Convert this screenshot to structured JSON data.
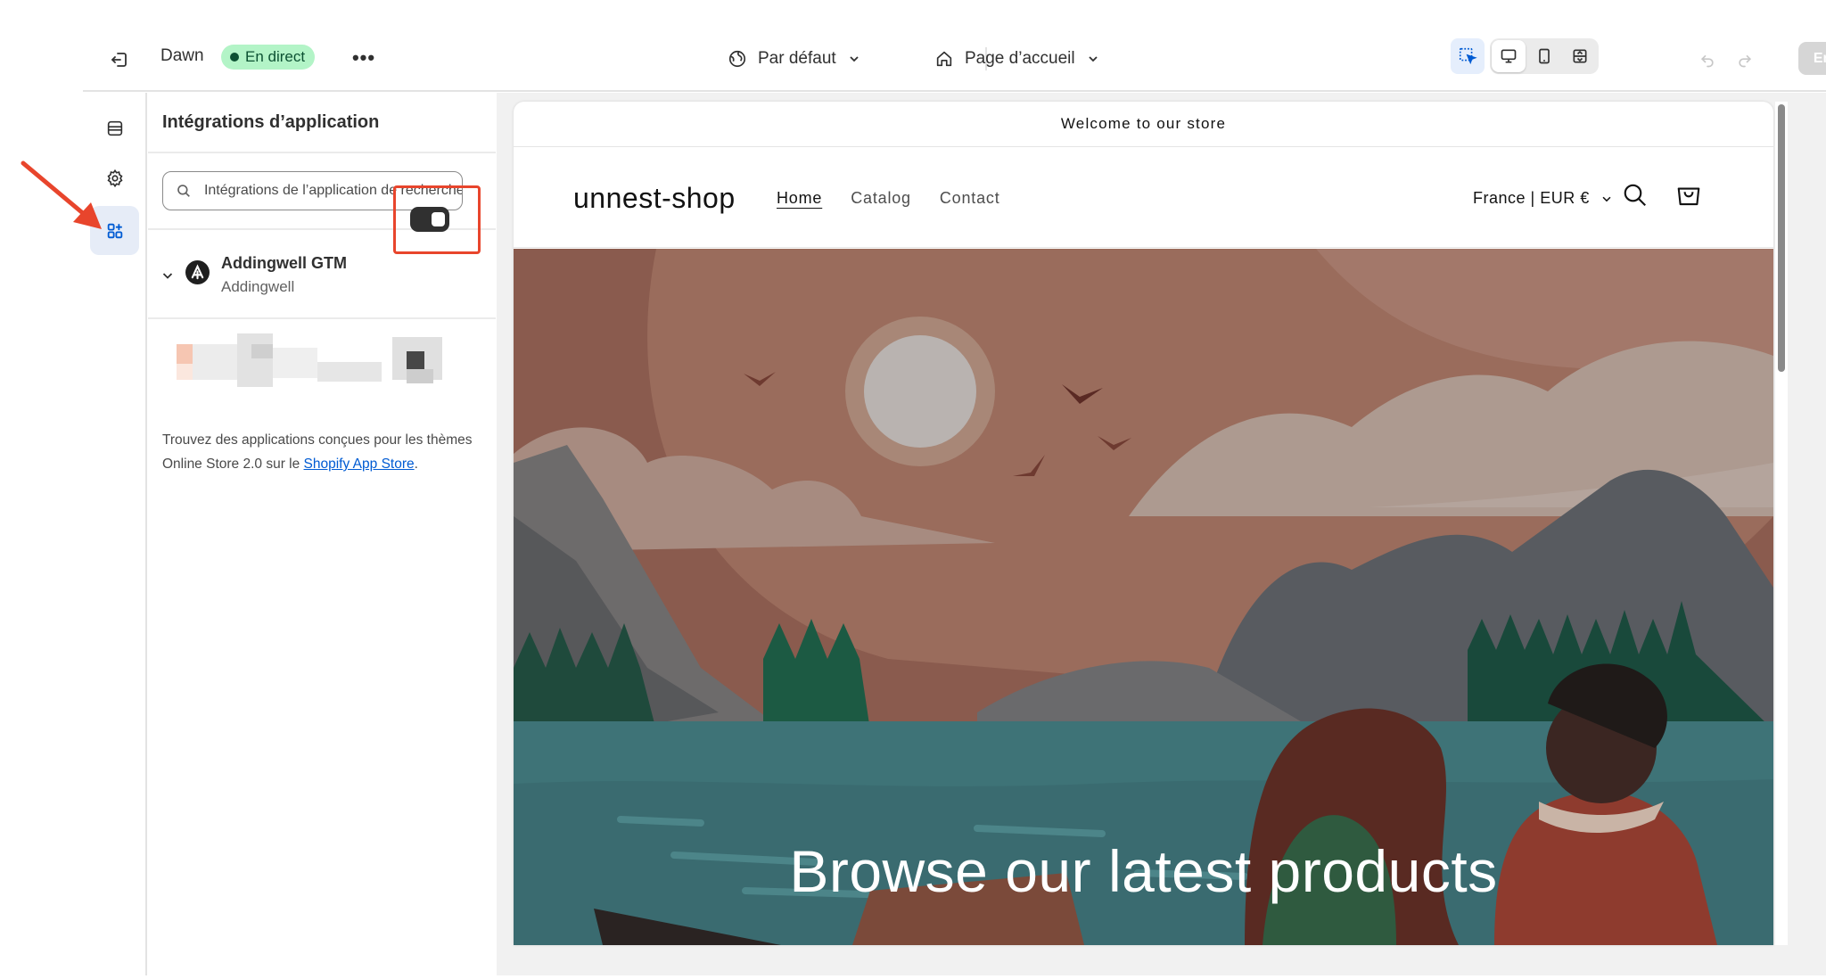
{
  "topbar": {
    "theme_name": "Dawn",
    "status_badge": "En direct",
    "more_label": "•••",
    "language_label": "Par défaut",
    "page_label": "Page d’accueil",
    "save_label": "Enregistrer",
    "icons": {
      "exit": "exit-icon",
      "globe": "globe-icon",
      "home": "home-icon",
      "inspector": "cursor-select-icon",
      "desktop": "desktop-icon",
      "mobile": "mobile-icon",
      "fullwidth": "fullscreen-icon",
      "undo": "undo-icon",
      "redo": "redo-icon"
    }
  },
  "rail": {
    "items": [
      {
        "name": "sections",
        "icon": "sections-icon"
      },
      {
        "name": "theme-settings",
        "icon": "gear-icon"
      },
      {
        "name": "app-embeds",
        "icon": "app-embed-icon",
        "active": true
      }
    ]
  },
  "panel": {
    "title": "Intégrations d’application",
    "search_placeholder": "Intégrations de l’application de recherche",
    "app": {
      "name": "Addingwell GTM",
      "vendor": "Addingwell",
      "enabled": true
    },
    "help_text": "Trouvez des applications conçues pour les thèmes Online Store 2.0 sur le ",
    "help_link": "Shopify App Store",
    "help_end": "."
  },
  "preview": {
    "announcement": "Welcome to our store",
    "shop_name": "unnest-shop",
    "nav": [
      "Home",
      "Catalog",
      "Contact"
    ],
    "locale": "France | EUR €",
    "hero_title": "Browse our latest products"
  },
  "colors": {
    "accent_blue": "#005bd3",
    "badge_bg": "#b3f4c7",
    "badge_text": "#0c5132",
    "highlight": "#e8452c"
  }
}
